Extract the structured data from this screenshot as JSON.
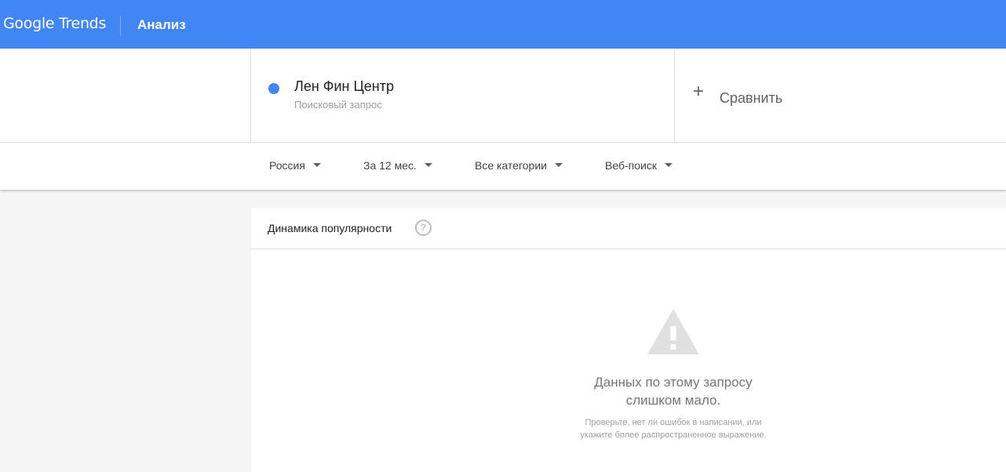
{
  "header": {
    "logo": "Google Trends",
    "title": "Анализ",
    "brand_color": "#4285f4"
  },
  "search": {
    "term": "Лен Фин Центр",
    "term_type": "Поисковый запрос",
    "term_color": "#4285f4",
    "compare_label": "Сравнить"
  },
  "filters": {
    "region": "Россия",
    "period": "За 12 мес.",
    "category": "Все категории",
    "search_type": "Веб-поиск"
  },
  "interest": {
    "title": "Динамика популярности",
    "help_icon": "help-icon",
    "warning_icon": "warning-icon",
    "message_line1": "Данных по этому запросу",
    "message_line2": "слишком мало.",
    "hint_line1": "Проверьте, нет ли ошибок в написании, или",
    "hint_line2": "укажите более распространенное выражение."
  }
}
